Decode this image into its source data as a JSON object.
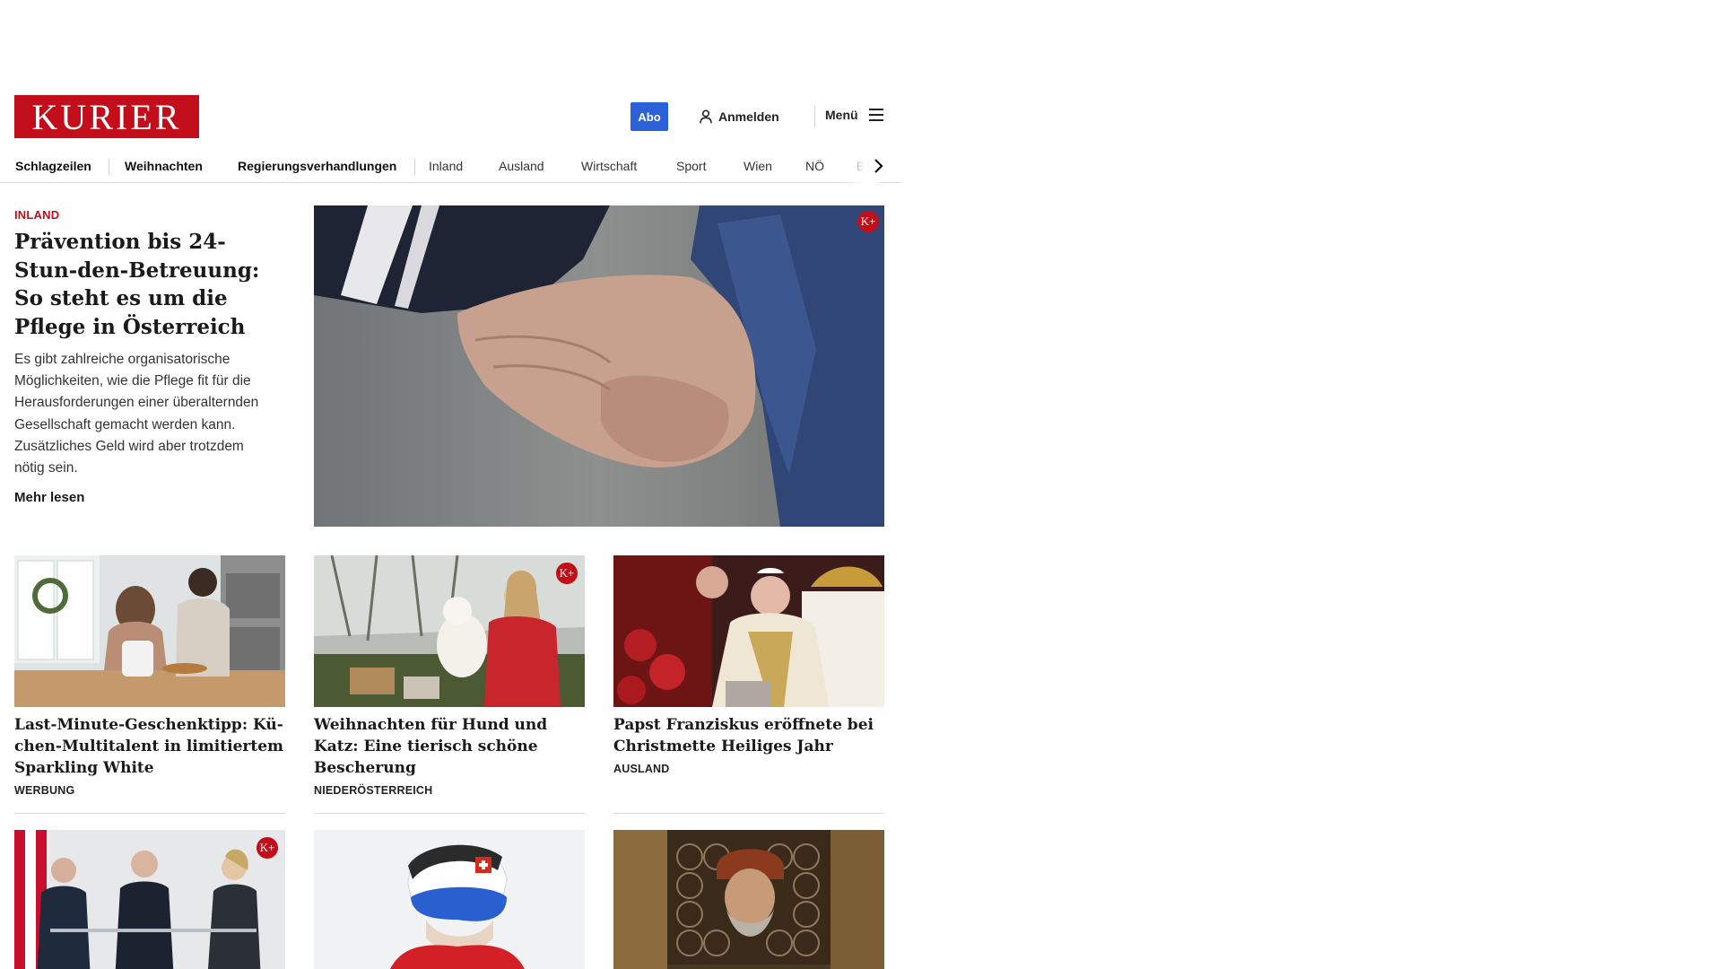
{
  "header": {
    "logo_text": "KURIER",
    "abo_label": "Abo",
    "login_label": "Anmelden",
    "menu_label": "Menü"
  },
  "nav": {
    "items": [
      "Schlagzeilen",
      "Weihnachten",
      "Regierungsverhandlungen",
      "Inland",
      "Ausland",
      "Wirtschaft",
      "Sport",
      "Wien",
      "NÖ",
      "Bu"
    ]
  },
  "hero": {
    "category": "INLAND",
    "title": "Prävention bis 24-Stun-den-Betreuung: So steht es um die Pflege in Österreich",
    "lead": "Es gibt zahlreiche organisatorische Möglichkeiten, wie die Pflege fit für die Herausforderungen einer überalternden Gesellschaft gemacht werden kann. Zusätzliches Geld wird aber trotzdem nötig sein.",
    "more_label": "Mehr lesen",
    "plus_badge": "K+"
  },
  "cards": [
    {
      "title": "Last-Minute-Geschenktipp: Kü-chen-Multitalent in limitiertem Sparkling White",
      "category": "WERBUNG",
      "plus": false
    },
    {
      "title": "Weihnachten für Hund und Katz: Eine tierisch schöne Bescherung",
      "category": "NIEDERÖSTERREICH",
      "plus": true
    },
    {
      "title": "Papst Franziskus eröffnete bei Christmette Heiliges Jahr",
      "category": "AUSLAND",
      "plus": false
    }
  ],
  "plus_badge": "K+",
  "colors": {
    "brand_red": "#c20e1a",
    "abo_blue": "#2b62d9"
  }
}
